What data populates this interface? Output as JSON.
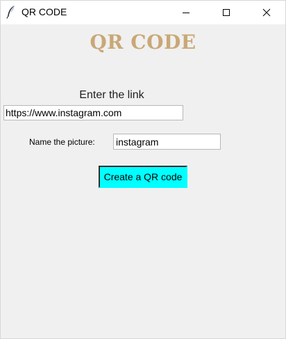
{
  "window": {
    "title": "QR CODE",
    "icon": "feather-icon",
    "controls": [
      "minimize-icon",
      "maximize-icon",
      "close-icon"
    ]
  },
  "main": {
    "heading": "QR CODE",
    "link_label": "Enter the link",
    "link_value": "https://www.instagram.com",
    "name_label": "Name the picture:",
    "name_value": "instagram",
    "create_button": "Create a QR code"
  },
  "colors": {
    "heading": "#c9a877",
    "button_bg": "#00ffff",
    "window_bg": "#f0f0f0"
  }
}
